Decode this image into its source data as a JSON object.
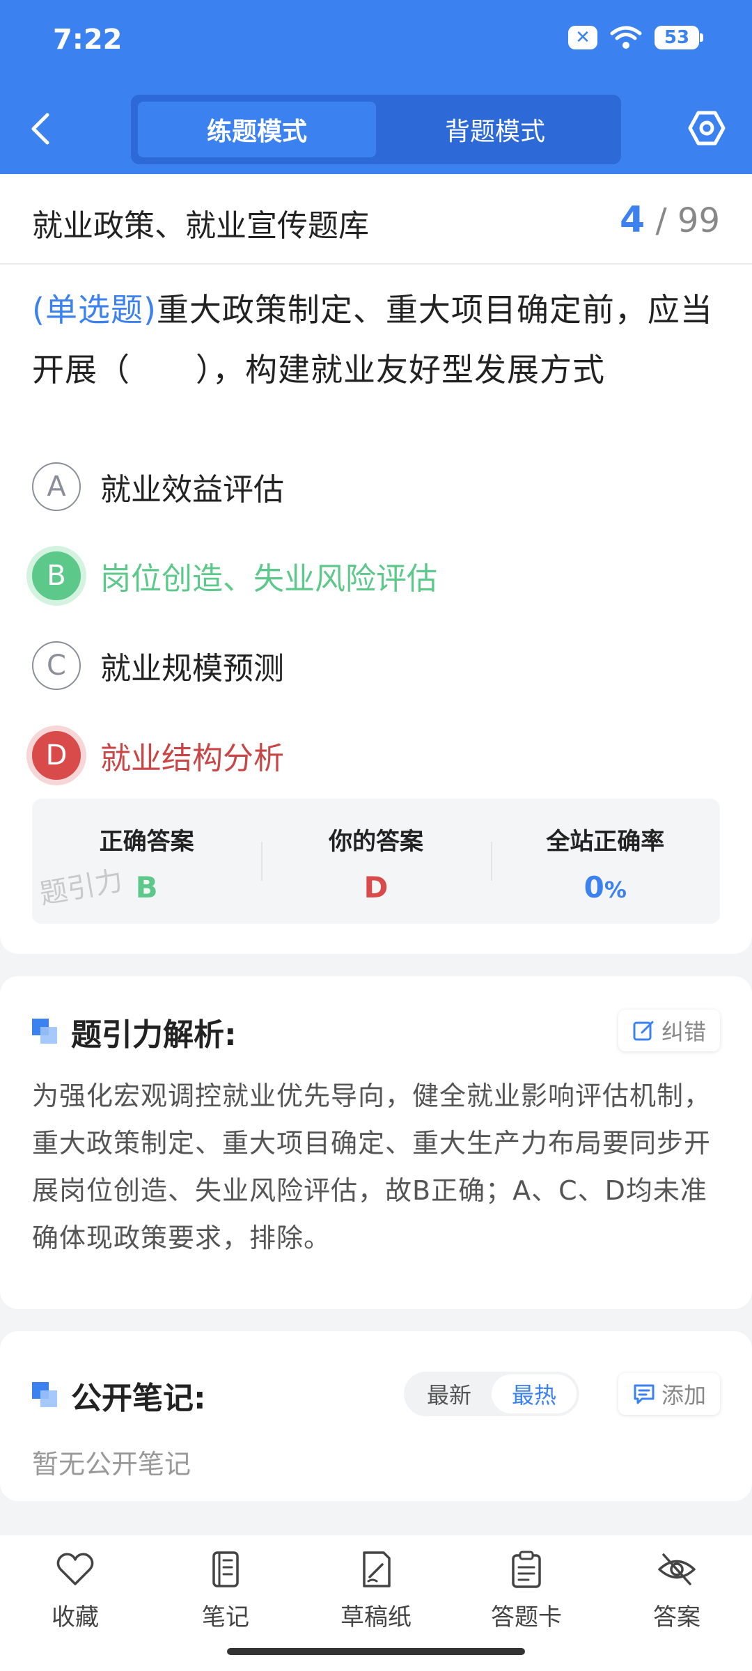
{
  "status_bar": {
    "time": "7:22",
    "battery": "53"
  },
  "header": {
    "tabs": [
      {
        "label": "练题模式",
        "active": true
      },
      {
        "label": "背题模式",
        "active": false
      }
    ]
  },
  "question_card": {
    "bank_title": "就业政策、就业宣传题库",
    "current": "4",
    "total": "/ 99",
    "question_type": "(单选题)",
    "question_text": "重大政策制定、重大项目确定前，应当开展（　　），构建就业友好型发展方式",
    "options": [
      {
        "letter": "A",
        "text": "就业效益评估",
        "state": "normal"
      },
      {
        "letter": "B",
        "text": "岗位创造、失业风险评估",
        "state": "correct"
      },
      {
        "letter": "C",
        "text": "就业规模预测",
        "state": "normal"
      },
      {
        "letter": "D",
        "text": "就业结构分析",
        "state": "wrong"
      }
    ],
    "answer_summary": {
      "correct_label": "正确答案",
      "correct_value": "B",
      "yours_label": "你的答案",
      "yours_value": "D",
      "rate_label": "全站正确率",
      "rate_value": "0",
      "rate_unit": "%"
    },
    "watermark": "题引力"
  },
  "analysis": {
    "title": "题引力解析:",
    "report_label": "纠错",
    "text": "为强化宏观调控就业优先导向，健全就业影响评估机制，重大政策制定、重大项目确定、重大生产力布局要同步开展岗位创造、失业风险评估，故B正确；A、C、D均未准确体现政策要求，排除。"
  },
  "notes": {
    "title": "公开笔记:",
    "sort_latest": "最新",
    "sort_hot": "最热",
    "add_label": "添加",
    "empty_text": "暂无公开笔记"
  },
  "bottom_nav": {
    "favorite": "收藏",
    "note": "笔记",
    "scratch": "草稿纸",
    "answer_card": "答题卡",
    "answer": "答案"
  },
  "colors": {
    "brand_blue": "#3b82f0",
    "correct_green": "#5cc98a",
    "wrong_red": "#d94b4b"
  }
}
